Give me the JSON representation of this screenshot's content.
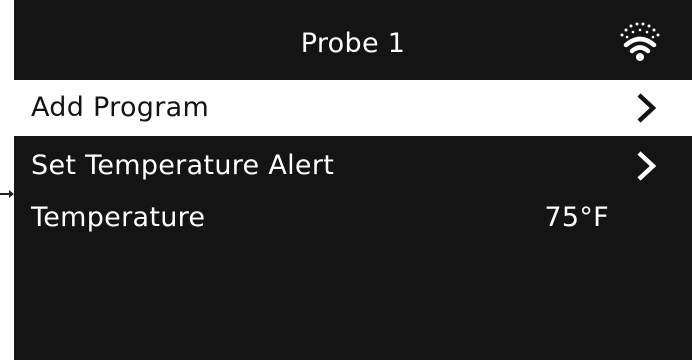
{
  "header": {
    "title": "Probe 1",
    "status_icon": "wifi-icon"
  },
  "menu": {
    "items": [
      {
        "label": "Add Program",
        "selected": true,
        "icon": "chevron-right-icon"
      },
      {
        "label": "Set Temperature Alert",
        "selected": false,
        "icon": "chevron-right-icon"
      },
      {
        "label": "Temperature",
        "value": "75°F",
        "selected": false
      }
    ]
  },
  "colors": {
    "screen_background": "#141414",
    "text": "#ffffff",
    "selected_background": "#ffffff",
    "selected_text": "#141414"
  }
}
